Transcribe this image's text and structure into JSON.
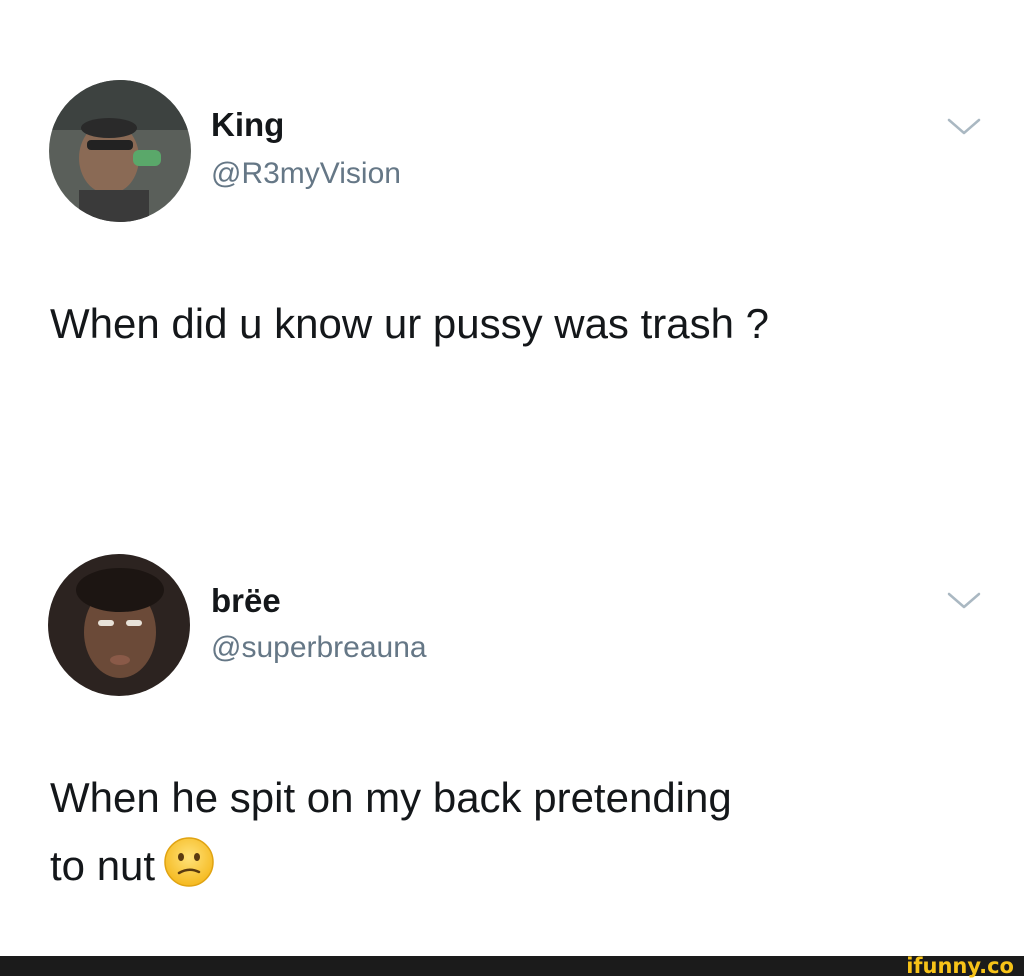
{
  "tweets": [
    {
      "display_name": "King",
      "handle": "@R3myVision",
      "text": "When did u know ur pussy was trash ?"
    },
    {
      "display_name": "brëe",
      "handle": "@superbreauna",
      "text_line1": "When he spit on my back pretending",
      "text_line2": "to nut",
      "emoji": "confused-face-emoji"
    }
  ],
  "icons": {
    "more": "chevron-down-icon"
  },
  "footer": {
    "watermark": "ifunny.co"
  },
  "colors": {
    "name": "#14171a",
    "handle": "#657786",
    "chevron": "#aab8c2",
    "footer": "#1b1b1b",
    "watermark": "#f7c318"
  }
}
